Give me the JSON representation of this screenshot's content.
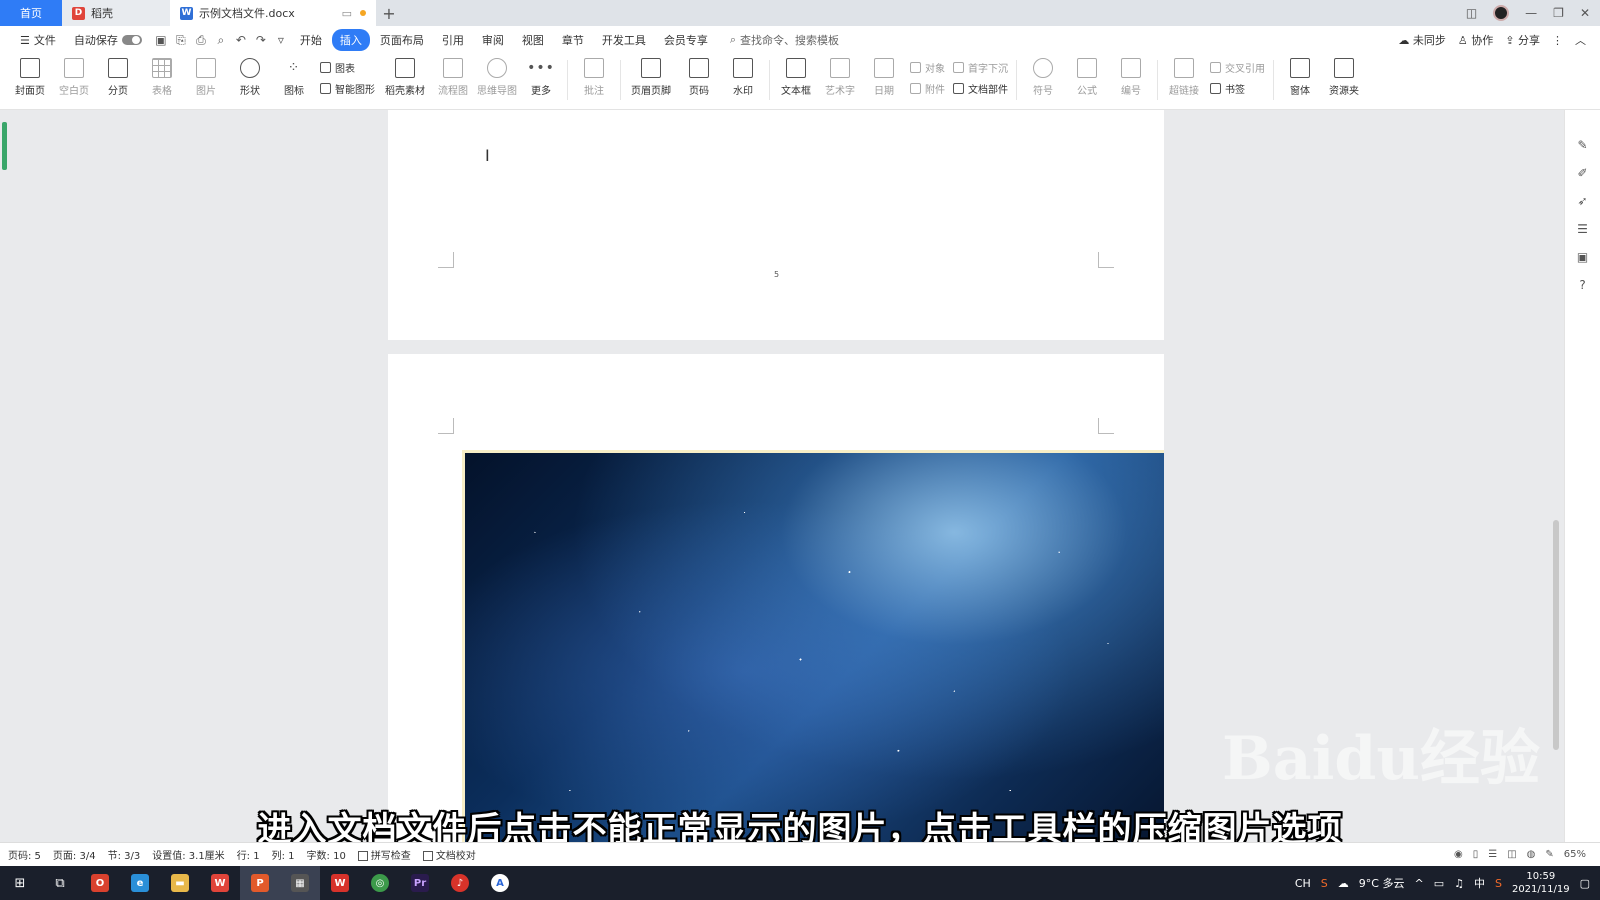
{
  "tabs": {
    "home": "首页",
    "daoke": "稻壳",
    "document": "示例文档文件.docx",
    "add": "+"
  },
  "menu": {
    "file": "文件",
    "autosave": "自动保存",
    "items": [
      "开始",
      "插入",
      "页面布局",
      "引用",
      "审阅",
      "视图",
      "章节",
      "开发工具",
      "会员专享"
    ],
    "active_index": 1,
    "search_placeholder": "查找命令、搜索模板",
    "sync": "未同步",
    "collab": "协作",
    "share": "分享"
  },
  "ribbon": {
    "cover": "封面页",
    "blank": "空白页",
    "pagebreak": "分页",
    "table": "表格",
    "picture": "图片",
    "shape": "形状",
    "icon": "图标",
    "chart": "图表",
    "smartart": "智能图形",
    "material": "稻壳素材",
    "flowchart": "流程图",
    "mindmap": "思维导图",
    "more": "更多",
    "comment": "批注",
    "header_footer": "页眉页脚",
    "page_number": "页码",
    "watermark": "水印",
    "textbox": "文本框",
    "wordart": "艺术字",
    "date": "日期",
    "object": "对象",
    "attachment": "附件",
    "dropcap": "首字下沉",
    "doc_parts": "文档部件",
    "symbol": "符号",
    "formula": "公式",
    "numbering": "编号",
    "hyperlink": "超链接",
    "cross_ref": "交叉引用",
    "bookmark": "书签",
    "font_set": "窗体",
    "resources": "资源夹"
  },
  "document": {
    "page_number_mark": "5"
  },
  "subtitle": "进入文档文件后点击不能正常显示的图片，点击工具栏的压缩图片选项",
  "watermark": "Baidu经验",
  "status": {
    "page_code": "页码: 5",
    "page": "页面: 3/4",
    "section": "节: 3/3",
    "setting": "设置值: 3.1厘米",
    "row": "行: 1",
    "col": "列: 1",
    "words": "字数: 10",
    "spellcheck": "拼写检查",
    "proofread": "文档校对",
    "zoom": "65%"
  },
  "taskbar": {
    "weather": "9°C 多云",
    "ime_lang": "中",
    "ime_ch": "CH",
    "time": "10:59",
    "date": "2021/11/19"
  },
  "colors": {
    "accent": "#2f7cf6",
    "taskbar": "#1a1f2b"
  }
}
